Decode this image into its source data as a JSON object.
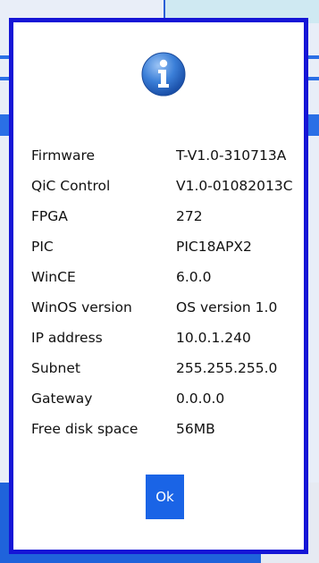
{
  "dialog": {
    "icon": "info-icon",
    "rows": [
      {
        "label": "Firmware",
        "value": "T-V1.0-310713A"
      },
      {
        "label": "QiC Control",
        "value": "V1.0-01082013C"
      },
      {
        "label": "FPGA",
        "value": "272"
      },
      {
        "label": "PIC",
        "value": "PIC18APX2"
      },
      {
        "label": "WinCE",
        "value": "6.0.0"
      },
      {
        "label": "WinOS version",
        "value": "OS version 1.0"
      },
      {
        "label": "IP address",
        "value": "10.0.1.240"
      },
      {
        "label": "Subnet",
        "value": "255.255.255.0"
      },
      {
        "label": "Gateway",
        "value": "0.0.0.0"
      },
      {
        "label": "Free disk space",
        "value": "56MB"
      }
    ],
    "ok_label": "Ok"
  },
  "colors": {
    "dialog_border": "#1515d6",
    "button": "#1a64e6",
    "background_accent": "#1f63db"
  }
}
